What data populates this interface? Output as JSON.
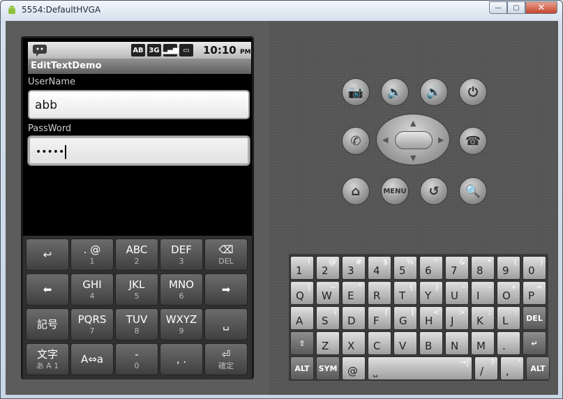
{
  "window": {
    "title": "5554:DefaultHVGA",
    "minimize_glyph": "—",
    "maximize_glyph": "▢",
    "close_glyph": "✕"
  },
  "statusbar": {
    "icons": [
      "AB",
      "3G",
      "▂▄▆",
      "▭"
    ],
    "time": "10:10",
    "ampm": "PM"
  },
  "app": {
    "title": "EditTextDemo",
    "username_label": "UserName",
    "username_value": "abb",
    "password_label": "PassWord",
    "password_value": "•••••"
  },
  "softkeyboard": {
    "rows": [
      [
        {
          "main": "↩",
          "sub": ""
        },
        {
          "main": ". @",
          "sub": "1"
        },
        {
          "main": "ABC",
          "sub": "2"
        },
        {
          "main": "DEF",
          "sub": "3"
        },
        {
          "main": "⌫",
          "sub": "DEL"
        }
      ],
      [
        {
          "main": "⬅",
          "sub": ""
        },
        {
          "main": "GHI",
          "sub": "4"
        },
        {
          "main": "JKL",
          "sub": "5"
        },
        {
          "main": "MNO",
          "sub": "6"
        },
        {
          "main": "➡",
          "sub": ""
        }
      ],
      [
        {
          "main": "記号",
          "sub": ""
        },
        {
          "main": "PQRS",
          "sub": "7"
        },
        {
          "main": "TUV",
          "sub": "8"
        },
        {
          "main": "WXYZ",
          "sub": "9"
        },
        {
          "main": "␣",
          "sub": ""
        }
      ],
      [
        {
          "main": "文字",
          "sub": "あ A 1"
        },
        {
          "main": "A⇔a",
          "sub": ""
        },
        {
          "main": "‐",
          "sub": "0"
        },
        {
          "main": ", .",
          "sub": ""
        },
        {
          "main": "⏎",
          "sub": "確定"
        }
      ]
    ]
  },
  "hardware_buttons": {
    "row1": [
      {
        "name": "camera",
        "glyph": "📷"
      },
      {
        "name": "volume-down",
        "glyph": "🔈"
      },
      {
        "name": "volume-up",
        "glyph": "🔊"
      },
      {
        "name": "power",
        "glyph": "⏻"
      }
    ],
    "call": "✆",
    "end_call": "☎",
    "row3": [
      {
        "name": "home",
        "glyph": "⌂"
      },
      {
        "name": "menu",
        "glyph": "MENU"
      },
      {
        "name": "back",
        "glyph": "↺"
      },
      {
        "name": "search",
        "glyph": "🔍"
      }
    ]
  },
  "qwerty": {
    "rows": [
      [
        {
          "p": "1",
          "a": "!"
        },
        {
          "p": "2",
          "a": "@"
        },
        {
          "p": "3",
          "a": "#"
        },
        {
          "p": "4",
          "a": "$"
        },
        {
          "p": "5",
          "a": "%"
        },
        {
          "p": "6",
          "a": "^"
        },
        {
          "p": "7",
          "a": "&"
        },
        {
          "p": "8",
          "a": "*"
        },
        {
          "p": "9",
          "a": "("
        },
        {
          "p": "0",
          "a": ")"
        }
      ],
      [
        {
          "p": "Q",
          "a": "|"
        },
        {
          "p": "W",
          "a": "~"
        },
        {
          "p": "E",
          "a": "\""
        },
        {
          "p": "R",
          "a": "`"
        },
        {
          "p": "T",
          "a": "{"
        },
        {
          "p": "Y",
          "a": "}"
        },
        {
          "p": "U",
          "a": "-"
        },
        {
          "p": "I",
          "a": "-"
        },
        {
          "p": "O",
          "a": "+"
        },
        {
          "p": "P",
          "a": "="
        }
      ],
      [
        {
          "p": "A",
          "a": ""
        },
        {
          "p": "S",
          "a": "\\"
        },
        {
          "p": "D",
          "a": "'"
        },
        {
          "p": "F",
          "a": "["
        },
        {
          "p": "G",
          "a": "]"
        },
        {
          "p": "H",
          "a": "<"
        },
        {
          "p": "J",
          "a": ">"
        },
        {
          "p": "K",
          "a": ";"
        },
        {
          "p": "L",
          "a": ":"
        },
        {
          "p": "DEL",
          "a": ""
        }
      ],
      [
        {
          "p": "⇧",
          "a": ""
        },
        {
          "p": "Z",
          "a": ""
        },
        {
          "p": "X",
          "a": ""
        },
        {
          "p": "C",
          "a": ""
        },
        {
          "p": "V",
          "a": ""
        },
        {
          "p": "B",
          "a": ""
        },
        {
          "p": "N",
          "a": ""
        },
        {
          "p": "M",
          "a": ""
        },
        {
          "p": ".",
          "a": ""
        },
        {
          "p": "↵",
          "a": ""
        }
      ],
      [
        {
          "p": "ALT",
          "a": ""
        },
        {
          "p": "SYM",
          "a": ""
        },
        {
          "p": "@",
          "a": ""
        },
        {
          "p": "⎵",
          "a": "→|"
        },
        {
          "p": "/",
          "a": "?"
        },
        {
          "p": ",",
          "a": "'"
        },
        {
          "p": "ALT",
          "a": ""
        }
      ]
    ]
  }
}
